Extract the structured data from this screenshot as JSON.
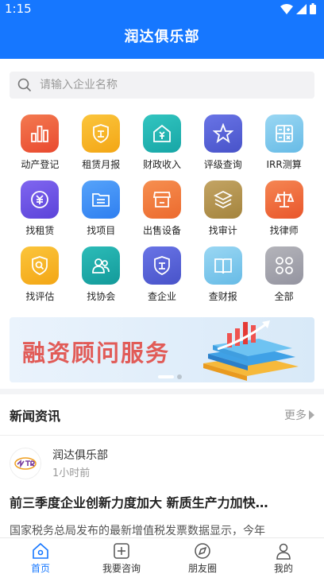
{
  "status": {
    "time": "1:15"
  },
  "header": {
    "title": "润达俱乐部"
  },
  "search": {
    "placeholder": "请输入企业名称"
  },
  "grid": [
    {
      "label": "动产登记",
      "icon": "bar-chart-icon",
      "color": "#ef5a3c"
    },
    {
      "label": "租赁月报",
      "icon": "shield-badge-icon",
      "color": "#f6b21c"
    },
    {
      "label": "财政收入",
      "icon": "house-yen-icon",
      "color": "#1fb5b3"
    },
    {
      "label": "评级查询",
      "icon": "star-icon",
      "color": "#5561d9"
    },
    {
      "label": "IRR测算",
      "icon": "calculator-icon",
      "color": "#7ac8ee"
    },
    {
      "label": "找租赁",
      "icon": "yen-circle-icon",
      "color": "#6c55e8"
    },
    {
      "label": "找项目",
      "icon": "folder-icon",
      "color": "#3d8ff5"
    },
    {
      "label": "出售设备",
      "icon": "store-icon",
      "color": "#f27a3d"
    },
    {
      "label": "找审计",
      "icon": "layers-icon",
      "color": "#b3924d"
    },
    {
      "label": "找律师",
      "icon": "scales-icon",
      "color": "#ef6b3b"
    },
    {
      "label": "找评估",
      "icon": "shield-search-icon",
      "color": "#f6b21c"
    },
    {
      "label": "找协会",
      "icon": "people-icon",
      "color": "#1aa9a9"
    },
    {
      "label": "查企业",
      "icon": "shield-badge-icon",
      "color": "#5561d9"
    },
    {
      "label": "查财报",
      "icon": "book-icon",
      "color": "#7ac8ee"
    },
    {
      "label": "全部",
      "icon": "four-petal-icon",
      "color": "#a2a2a8"
    }
  ],
  "banner": {
    "text": "融资顾问服务"
  },
  "news": {
    "title": "新闻资讯",
    "more": "更多",
    "post": {
      "author": "润达俱乐部",
      "time": "1小时前",
      "headline": "前三季度企业创新力度加大 新质生产力加快…",
      "excerpt": "国家税务总局发布的最新增值税发票数据显示，今年"
    }
  },
  "tabs": [
    {
      "label": "首页",
      "icon": "home-icon",
      "active": true
    },
    {
      "label": "我要咨询",
      "icon": "plus-square-icon",
      "active": false
    },
    {
      "label": "朋友圈",
      "icon": "compass-icon",
      "active": false
    },
    {
      "label": "我的",
      "icon": "person-icon",
      "active": false
    }
  ],
  "colors": {
    "primary": "#1677ff",
    "banner_text": "#e15b57"
  }
}
